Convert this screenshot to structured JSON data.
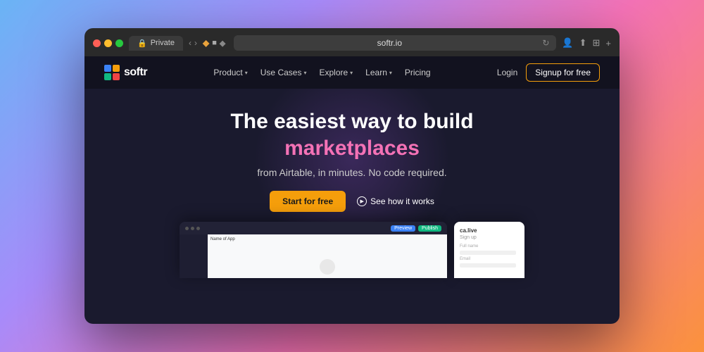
{
  "browser": {
    "url": "softr.io",
    "tab_label": "Private"
  },
  "nav": {
    "logo_text": "softr",
    "links": [
      {
        "label": "Product",
        "has_dropdown": true
      },
      {
        "label": "Use Cases",
        "has_dropdown": true
      },
      {
        "label": "Explore",
        "has_dropdown": true
      },
      {
        "label": "Learn",
        "has_dropdown": true
      },
      {
        "label": "Pricing",
        "has_dropdown": false
      }
    ],
    "login_label": "Login",
    "signup_label": "Signup for free"
  },
  "hero": {
    "line1": "The easiest way to build",
    "line2": "marketplaces",
    "line3": "from Airtable, in minutes. No code required.",
    "cta_primary": "Start for free",
    "cta_secondary": "See how it works"
  },
  "preview": {
    "main_btn1": "Preview",
    "main_btn2": "Publish",
    "card_title": "ca.live",
    "card_sub": "Sign up",
    "app_name": "Name of App"
  }
}
